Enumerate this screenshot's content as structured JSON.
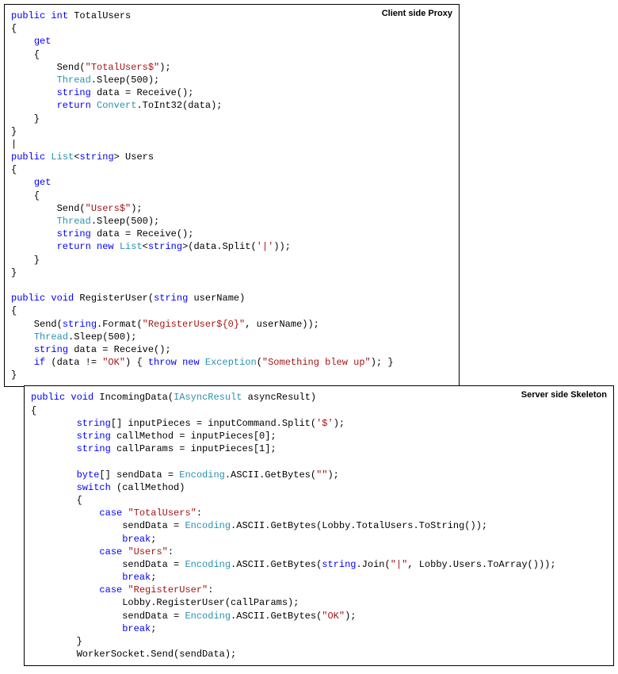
{
  "panels": {
    "client": {
      "label": "Client side Proxy"
    },
    "server": {
      "label": "Server side Skeleton"
    }
  },
  "code": {
    "client": {
      "l0": {
        "t1": "public",
        "t2": "int",
        "t3": " TotalUsers"
      },
      "l1": "{",
      "l2": {
        "t1": "get"
      },
      "l3": "    {",
      "l4": {
        "pre": "        Send(",
        "s": "\"TotalUsers$\"",
        "post": ");"
      },
      "l5": {
        "pre": "        ",
        "typ": "Thread",
        "post": ".Sleep(500);"
      },
      "l6": {
        "t1": "string",
        "rest": " data = Receive();"
      },
      "l7": {
        "t1": "return",
        "sp": " ",
        "typ": "Convert",
        "post": ".ToInt32(data);"
      },
      "l8": "    }",
      "l9": "}",
      "l10": "|",
      "l11": {
        "t1": "public",
        "sp": " ",
        "typ": "List",
        "lt": "<",
        "t2": "string",
        "gt": "> Users"
      },
      "l12": "{",
      "l13": {
        "t1": "get"
      },
      "l14": "    {",
      "l15": {
        "pre": "        Send(",
        "s": "\"Users$\"",
        "post": ");"
      },
      "l16": {
        "pre": "        ",
        "typ": "Thread",
        "post": ".Sleep(500);"
      },
      "l17": {
        "t1": "string",
        "rest": " data = Receive();"
      },
      "l18": {
        "t1": "return",
        "sp": " ",
        "t2": "new",
        "sp2": " ",
        "typ": "List",
        "lt": "<",
        "t3": "string",
        "gt": ">(data.Split(",
        "s": "'|'",
        "post": "));"
      },
      "l19": "    }",
      "l20": "}",
      "l21": "",
      "l22": {
        "t1": "public",
        "t2": "void",
        "rest": " RegisterUser(",
        "t3": "string",
        "rest2": " userName)"
      },
      "l23": "{",
      "l24": {
        "pre": "    Send(",
        "t1": "string",
        "mid": ".Format(",
        "s": "\"RegisterUser${0}\"",
        "post": ", userName));"
      },
      "l25": {
        "pre": "    ",
        "typ": "Thread",
        "post": ".Sleep(500);"
      },
      "l26": {
        "t1": "string",
        "rest": " data = Receive();"
      },
      "l27": {
        "t1": "if",
        "cond": " (data != ",
        "s": "\"OK\"",
        "mid": ") { ",
        "t2": "throw",
        "sp": " ",
        "t3": "new",
        "sp2": " ",
        "typ": "Exception",
        "open": "(",
        "s2": "\"Something blew up\"",
        "post": "); }"
      },
      "l28": "}"
    },
    "server": {
      "l0": {
        "t1": "public",
        "t2": "void",
        "rest": " IncomingData(",
        "typ": "IAsyncResult",
        "rest2": " asyncResult)"
      },
      "l1": "{",
      "l2": {
        "t1": "string",
        "rest": "[] inputPieces = inputCommand.Split(",
        "s": "'$'",
        "post": ");"
      },
      "l3": {
        "t1": "string",
        "rest": " callMethod = inputPieces[0];"
      },
      "l4": {
        "t1": "string",
        "rest": " callParams = inputPieces[1];"
      },
      "l5": "",
      "l6": {
        "t1": "byte",
        "rest": "[] sendData = ",
        "typ": "Encoding",
        "mid": ".ASCII.GetBytes(",
        "s": "\"\"",
        "post": ");"
      },
      "l7": {
        "t1": "switch",
        "rest": " (callMethod)"
      },
      "l8": "        {",
      "l9": {
        "t1": "case",
        "sp": " ",
        "s": "\"TotalUsers\"",
        "post": ":"
      },
      "l10": {
        "pre": "                sendData = ",
        "typ": "Encoding",
        "post": ".ASCII.GetBytes(Lobby.TotalUsers.ToString());"
      },
      "l11": {
        "t1": "break",
        "post": ";"
      },
      "l12": {
        "t1": "case",
        "sp": " ",
        "s": "\"Users\"",
        "post": ":"
      },
      "l13": {
        "pre": "                sendData = ",
        "typ": "Encoding",
        "mid": ".ASCII.GetBytes(",
        "t2": "string",
        "mid2": ".Join(",
        "s": "\"|\"",
        "post": ", Lobby.Users.ToArray()));"
      },
      "l14": {
        "t1": "break",
        "post": ";"
      },
      "l15": {
        "t1": "case",
        "sp": " ",
        "s": "\"RegisterUser\"",
        "post": ":"
      },
      "l16": "                Lobby.RegisterUser(callParams);",
      "l17": {
        "pre": "                sendData = ",
        "typ": "Encoding",
        "mid": ".ASCII.GetBytes(",
        "s": "\"OK\"",
        "post": ");"
      },
      "l18": {
        "t1": "break",
        "post": ";"
      },
      "l19": "        }",
      "l20": "        WorkerSocket.Send(sendData);"
    }
  }
}
